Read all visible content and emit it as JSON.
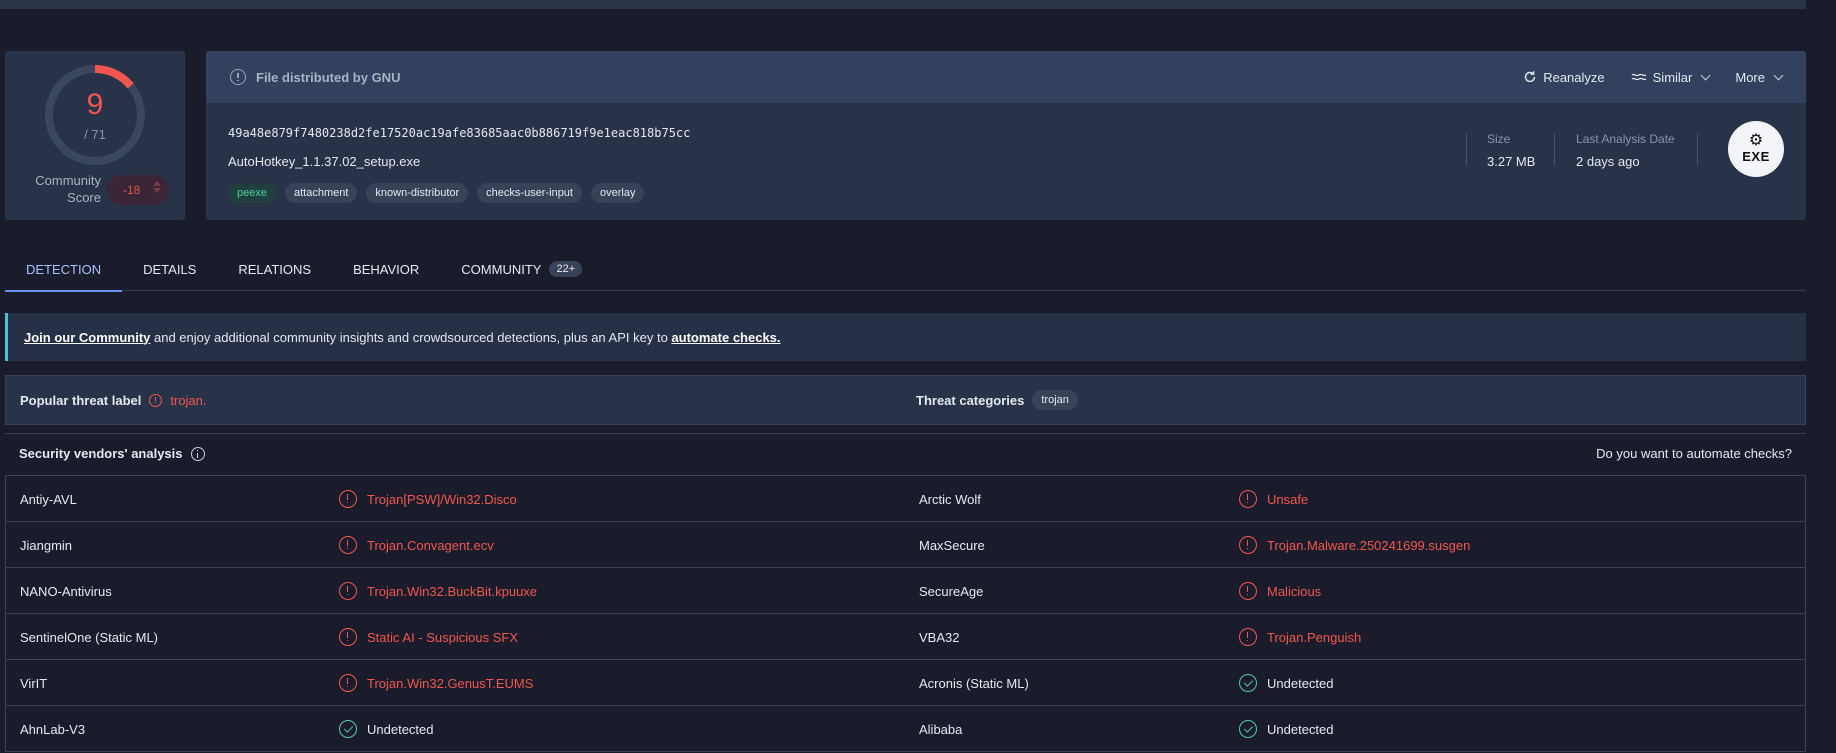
{
  "score": {
    "detections": "9",
    "total": "/ 71",
    "community_label": "Community Score",
    "community_value": "-18"
  },
  "file": {
    "distributed_by": "File distributed by GNU",
    "actions": {
      "reanalyze": "Reanalyze",
      "similar": "Similar",
      "more": "More"
    },
    "hash": "49a48e879f7480238d2fe17520ac19afe83685aac0b886719f9e1eac818b75cc",
    "name": "AutoHotkey_1.1.37.02_setup.exe",
    "tags": [
      "peexe",
      "attachment",
      "known-distributor",
      "checks-user-input",
      "overlay"
    ],
    "size_label": "Size",
    "size_value": "3.27 MB",
    "last_analysis_label": "Last Analysis Date",
    "last_analysis_value": "2 days ago",
    "type_badge": "EXE"
  },
  "tabs": [
    {
      "label": "DETECTION"
    },
    {
      "label": "DETAILS"
    },
    {
      "label": "RELATIONS"
    },
    {
      "label": "BEHAVIOR"
    },
    {
      "label": "COMMUNITY",
      "count": "22+"
    }
  ],
  "banner": {
    "link1": "Join our Community",
    "middle": " and enjoy additional community insights and crowdsourced detections, plus an API key to ",
    "link2": "automate checks."
  },
  "threat": {
    "popular_label": "Popular threat label",
    "popular_value": "trojan.",
    "categories_label": "Threat categories",
    "categories_value": "trojan"
  },
  "vendors": {
    "heading": "Security vendors' analysis",
    "automate": "Do you want to automate checks?",
    "rows": [
      {
        "v1": "Antiy-AVL",
        "r1": "Trojan[PSW]/Win32.Disco",
        "s1": "mal",
        "v2": "Arctic Wolf",
        "r2": "Unsafe",
        "s2": "mal"
      },
      {
        "v1": "Jiangmin",
        "r1": "Trojan.Convagent.ecv",
        "s1": "mal",
        "v2": "MaxSecure",
        "r2": "Trojan.Malware.250241699.susgen",
        "s2": "mal"
      },
      {
        "v1": "NANO-Antivirus",
        "r1": "Trojan.Win32.BuckBit.kpuuxe",
        "s1": "mal",
        "v2": "SecureAge",
        "r2": "Malicious",
        "s2": "mal"
      },
      {
        "v1": "SentinelOne (Static ML)",
        "r1": "Static AI - Suspicious SFX",
        "s1": "mal",
        "v2": "VBA32",
        "r2": "Trojan.Penguish",
        "s2": "mal"
      },
      {
        "v1": "VirIT",
        "r1": "Trojan.Win32.GenusT.EUMS",
        "s1": "mal",
        "v2": "Acronis (Static ML)",
        "r2": "Undetected",
        "s2": "ok"
      },
      {
        "v1": "AhnLab-V3",
        "r1": "Undetected",
        "s1": "ok",
        "v2": "Alibaba",
        "r2": "Undetected",
        "s2": "ok"
      }
    ]
  },
  "colors": {
    "malicious": "#f0564f",
    "clean": "#4fcf9b",
    "accent": "#6f8ff5",
    "banner_accent": "#44c4d4"
  }
}
